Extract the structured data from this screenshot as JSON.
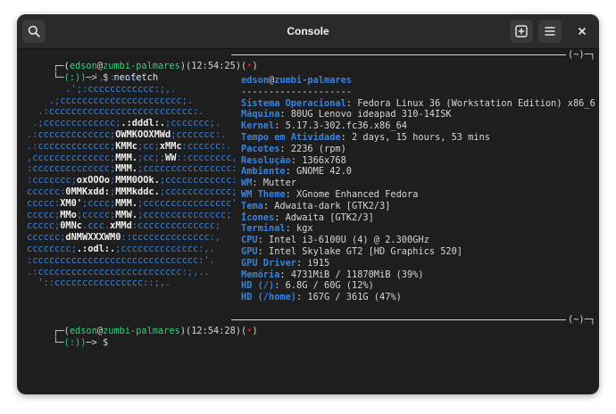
{
  "window": {
    "title": "Console"
  },
  "headerbar": {
    "search_icon": "search-icon",
    "new_tab_icon": "new-tab-icon",
    "menu_icon": "hamburger-menu-icon",
    "close_label": "×"
  },
  "prompt1": {
    "corner": "┌─",
    "open": "(",
    "user": "edson",
    "at": "@",
    "host": "zumbi-palmares",
    "mid": ")(",
    "time": "12:54:25",
    "mid2": ")(",
    "dot": "•",
    "close": ")",
    "tail": "(~)─┐"
  },
  "cmd1": {
    "corner": "└─",
    "smile": "(:))",
    "arrow": "─> ",
    "sign": "$ ",
    "text": "neofetch"
  },
  "logo": [
    "           .',;::::;,'.",
    "       .';:cccccccccccc:;,.",
    "    .;cccccccccccccccccccccc;.",
    "  .:cccccccccccccccccccccccccc:.",
    " .;ccccccccccccc;.:dddl:.;ccccccc;.",
    ".:ccccccccccccc;OWMKOOXMWd;ccccccc:.",
    ".:ccccccccccccc;KMMc;cc;xMMc:cccccc:.",
    ",cccccccccccccc;MMM.;cc;;WW::cccccccc,",
    ":cccccccccccccc;MMM.;cccccccccccccccc:",
    ":ccccccc;oxOOOo;MMM0OOk.;cccccccccccc:",
    "cccccc:0MMKxdd:;MMMkddc.;cccccccccccc;",
    "ccccc:XM0';cccc;MMM.;cccccccccccccccc'",
    "ccccc;MMo;ccccc;MMW.;ccccccccccccccc;",
    "ccccc;0MNc.ccc.xMMd:cccccccccccccc;",
    "cccccc;dNMWXXXWM0::cccccccccccccc:,",
    "cccccccc;.:odl:.;cccccccccccccc:,.",
    ":cccccccccccccccccccccccccccccc:'.",
    ".:cccccccccccccccccccccccccc:;,..",
    "  '::cccccccccccccccc::;,."
  ],
  "logo_bold_spans": [
    [
      4,
      ".:dddl:."
    ],
    [
      5,
      "OWMKOOXMWd"
    ],
    [
      6,
      "KMMc"
    ],
    [
      6,
      "xMMc"
    ],
    [
      7,
      "MMM."
    ],
    [
      7,
      "WW"
    ],
    [
      8,
      "MMM."
    ],
    [
      9,
      "oxOOOo"
    ],
    [
      9,
      "MMM0OOk."
    ],
    [
      10,
      "0MMKxdd:"
    ],
    [
      10,
      "MMMkddc."
    ],
    [
      11,
      "XM0'"
    ],
    [
      11,
      "MMM."
    ],
    [
      12,
      "MMo"
    ],
    [
      12,
      "MMW."
    ],
    [
      13,
      "0MNc"
    ],
    [
      13,
      "xMMd"
    ],
    [
      14,
      "dNMWXXXWM0"
    ],
    [
      15,
      ".:odl:."
    ]
  ],
  "info": {
    "user": "edson",
    "at": "@",
    "host": "zumbi-palmares",
    "separator": "--------------------",
    "rows": [
      {
        "label": "Sistema Operacional",
        "value": "Fedora Linux 36 (Workstation Edition) x86_6"
      },
      {
        "label": "Máquina",
        "value": "80UG Lenovo ideapad 310-14ISK"
      },
      {
        "label": "Kernel",
        "value": "5.17.3-302.fc36.x86_64"
      },
      {
        "label": "Tempo em Atividade",
        "value": "2 days, 15 hours, 53 mins"
      },
      {
        "label": "Pacotes",
        "value": "2236 (rpm)"
      },
      {
        "label": "Resolução",
        "value": "1366x768"
      },
      {
        "label": "Ambiente",
        "value": "GNOME 42.0"
      },
      {
        "label": "WM",
        "value": "Mutter"
      },
      {
        "label": "WM Theme",
        "value": "XGnome Enhanced Fedora"
      },
      {
        "label": "Tema",
        "value": "Adwaita-dark [GTK2/3]"
      },
      {
        "label": "Ícones",
        "value": "Adwaita [GTK2/3]"
      },
      {
        "label": "Terminal",
        "value": "kgx"
      },
      {
        "label": "CPU",
        "value": "Intel i3-6100U (4) @ 2.300GHz"
      },
      {
        "label": "GPU",
        "value": "Intel Skylake GT2 [HD Graphics 520]"
      },
      {
        "label": "GPU Driver",
        "value": "i915"
      },
      {
        "label": "Memória",
        "value": "4731MiB / 11870MiB (39%)"
      },
      {
        "label": "HD (/)",
        "value": "6.8G / 60G (12%)"
      },
      {
        "label": "HD (/home)",
        "value": "167G / 361G (47%)"
      }
    ]
  },
  "prompt2": {
    "corner": "┌─",
    "open": "(",
    "user": "edson",
    "at": "@",
    "host": "zumbi-palmares",
    "mid": ")(",
    "time": "12:54:28",
    "mid2": ")(",
    "dot": "•",
    "close": ")",
    "tail": "(~)─┐"
  },
  "cmd2": {
    "corner": "└─",
    "smile": "(:))",
    "arrow": "─> ",
    "sign": "$ "
  },
  "colors": {
    "accent_blue": "#3584e4",
    "prompt_green": "#33d17a",
    "dot_red": "#e01b24",
    "background": "#1e1e1e"
  }
}
